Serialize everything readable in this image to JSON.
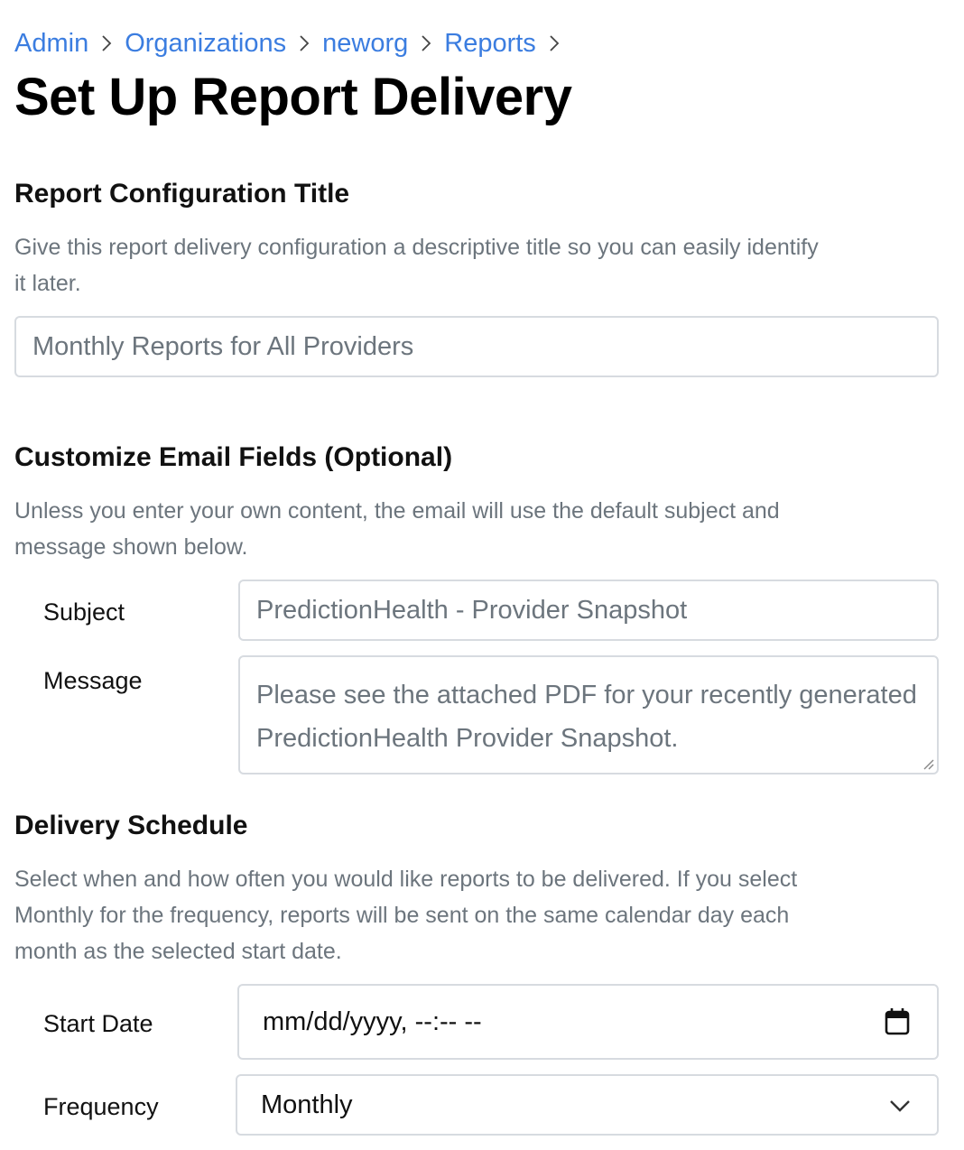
{
  "breadcrumb": {
    "items": [
      "Admin",
      "Organizations",
      "neworg",
      "Reports"
    ]
  },
  "page_title": "Set Up Report Delivery",
  "report_config": {
    "title": "Report Configuration Title",
    "help": "Give this report delivery configuration a descriptive title so you can easily identify it later.",
    "input_placeholder": "Monthly Reports for All Providers"
  },
  "email_fields": {
    "title": "Customize Email Fields (Optional)",
    "help": "Unless you enter your own content, the email will use the default subject and message shown below.",
    "subject_label": "Subject",
    "subject_placeholder": "PredictionHealth - Provider Snapshot",
    "message_label": "Message",
    "message_placeholder": "Please see the attached PDF for your recently generated PredictionHealth Provider Snapshot."
  },
  "schedule": {
    "title": "Delivery Schedule",
    "help": "Select when and how often you would like reports to be delivered. If you select Monthly for the frequency, reports will be sent on the same calendar day each month as the selected start date.",
    "start_date_label": "Start Date",
    "start_date_value": "mm/dd/yyyy, --:-- --",
    "frequency_label": "Frequency",
    "frequency_value": "Monthly"
  },
  "icons": {
    "breadcrumb_separator": "chevron-right-icon",
    "date_picker": "calendar-icon",
    "select": "chevron-down-icon",
    "textarea_resize": "resize-handle-icon"
  },
  "colors": {
    "link": "#3b7de0",
    "muted_text": "#6c757d",
    "border": "#d7dbe0"
  }
}
